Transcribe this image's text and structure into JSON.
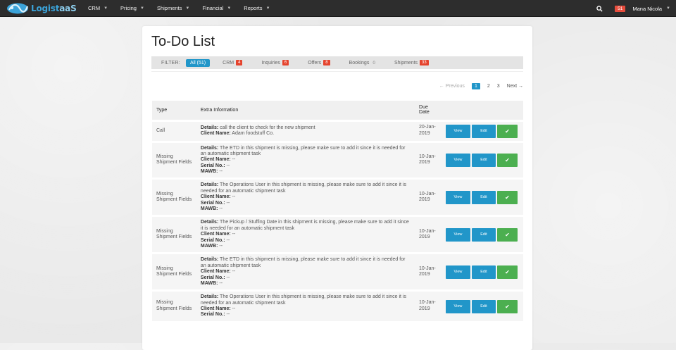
{
  "nav": {
    "logo_main": "Logist",
    "logo_accent": "aaS",
    "menu": [
      {
        "label": "CRM"
      },
      {
        "label": "Pricing"
      },
      {
        "label": "Shipments"
      },
      {
        "label": "Financial"
      },
      {
        "label": "Reports"
      }
    ],
    "notification_count": "51",
    "user_name": "Mana Nicola"
  },
  "page": {
    "title": "To-Do List"
  },
  "filter": {
    "label": "FILTER:",
    "tabs": [
      {
        "label": "All (51)",
        "count": ""
      },
      {
        "label": "CRM",
        "count": "4"
      },
      {
        "label": "Inquiries",
        "count": "6"
      },
      {
        "label": "Offers",
        "count": "8"
      },
      {
        "label": "Bookings",
        "count": "0"
      },
      {
        "label": "Shipments",
        "count": "33"
      }
    ]
  },
  "pagination": {
    "prev": "← Previous",
    "pages": [
      "1",
      "2",
      "3"
    ],
    "next": "Next →"
  },
  "table": {
    "headers": {
      "type": "Type",
      "info": "Extra Information",
      "due": "Due Date"
    },
    "labels": {
      "details": "Details:",
      "client": "Client Name:",
      "serial": "Serial No.:",
      "mawb": "MAWB:"
    },
    "buttons": {
      "view": "View",
      "edit": "Edit",
      "done": "✔"
    },
    "rows": [
      {
        "type": "Call",
        "details": " call the client to check for the new shipment",
        "client": " Adam foodstuff Co.",
        "serial": "",
        "mawb": "",
        "due": "20-Jan-2019"
      },
      {
        "type": "Missing Shipment Fields",
        "details": " The ETD in this shipment is missing, please make sure to add it since it is needed for an automatic shipment task",
        "client": " --",
        "serial": " --",
        "mawb": " --",
        "due": "10-Jan-2019"
      },
      {
        "type": "Missing Shipment Fields",
        "details": " The Operations User in this shipment is missing, please make sure to add it since it is needed for an automatic shipment task",
        "client": " --",
        "serial": " --",
        "mawb": " --",
        "due": "10-Jan-2019"
      },
      {
        "type": "Missing Shipment Fields",
        "details": " The Pickup / Stuffing Date in this shipment is missing, please make sure to add it since it is needed for an automatic shipment task",
        "client": " --",
        "serial": " --",
        "mawb": " --",
        "due": "10-Jan-2019"
      },
      {
        "type": "Missing Shipment Fields",
        "details": " The ETD in this shipment is missing, please make sure to add it since it is needed for an automatic shipment task",
        "client": " --",
        "serial": " --",
        "mawb": " --",
        "due": "10-Jan-2019"
      },
      {
        "type": "Missing Shipment Fields",
        "details": " The Operations User in this shipment is missing, please make sure to add it since it is needed for an automatic shipment task",
        "client": " --",
        "serial": " --",
        "mawb": "",
        "due": "10-Jan-2019"
      }
    ]
  },
  "colors": {
    "accent": "#2196c9",
    "success": "#4caf50",
    "badge": "#e5442e",
    "navbar": "#2d2d2d"
  }
}
